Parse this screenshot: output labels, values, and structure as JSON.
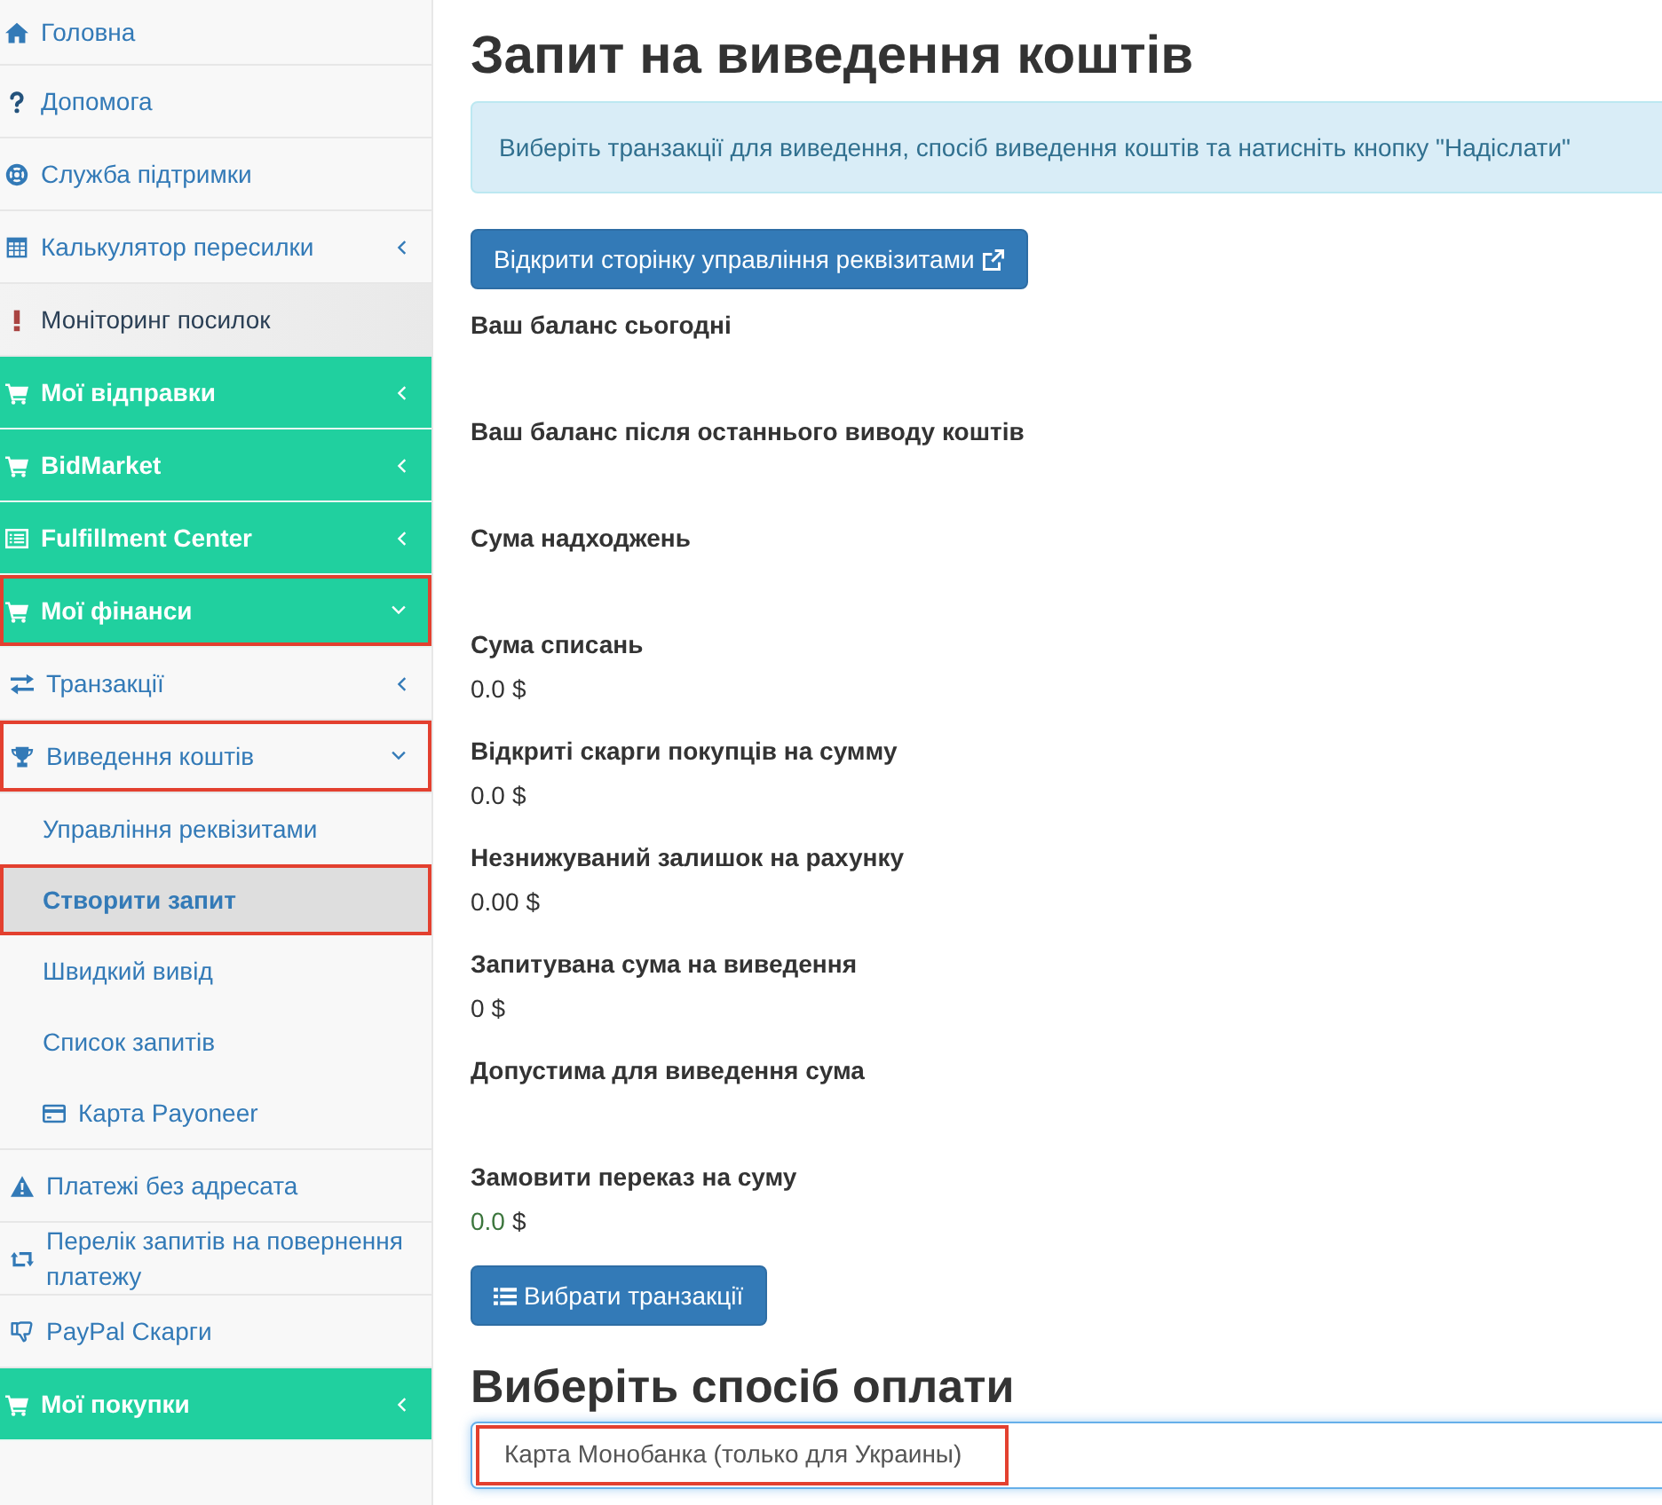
{
  "sidebar": {
    "items": [
      {
        "label": "Головна",
        "kind": "link",
        "selected": false,
        "hovered": false,
        "marked": false
      },
      {
        "label": "Допомога",
        "kind": "link",
        "selected": false,
        "hovered": false,
        "marked": false
      },
      {
        "label": "Служба підтримки",
        "kind": "link",
        "selected": false,
        "hovered": false,
        "marked": false
      },
      {
        "label": "Калькулятор пересилки",
        "kind": "link",
        "selected": false,
        "hovered": false,
        "marked": false,
        "expanded": false
      },
      {
        "label": "Моніторинг посилок",
        "kind": "link",
        "selected": false,
        "hovered": true,
        "marked": false
      },
      {
        "label": "Мої відправки",
        "kind": "section",
        "selected": false,
        "hovered": false,
        "marked": false,
        "expanded": false
      },
      {
        "label": "BidMarket",
        "kind": "section",
        "selected": false,
        "hovered": false,
        "marked": false,
        "expanded": false
      },
      {
        "label": "Fulfillment Center",
        "kind": "section",
        "selected": false,
        "hovered": false,
        "marked": false,
        "expanded": false
      },
      {
        "label": "Мої фінанси",
        "kind": "section",
        "selected": false,
        "hovered": false,
        "marked": true,
        "expanded": true,
        "children": [
          {
            "label": "Транзакції",
            "selected": false,
            "hovered": false,
            "marked": false,
            "expanded": false
          },
          {
            "label": "Виведення коштів",
            "selected": false,
            "hovered": false,
            "marked": true,
            "expanded": true,
            "children": [
              {
                "label": "Управління реквізитами",
                "selected": false,
                "hovered": false,
                "marked": false
              },
              {
                "label": "Створити запит",
                "selected": true,
                "hovered": false,
                "marked": true
              },
              {
                "label": "Швидкий вивід",
                "selected": false,
                "hovered": false,
                "marked": false
              },
              {
                "label": "Список запитів",
                "selected": false,
                "hovered": false,
                "marked": false
              },
              {
                "label": "Карта Payoneer",
                "selected": false,
                "hovered": false,
                "marked": false
              }
            ]
          },
          {
            "label": "Платежі без адресата",
            "selected": false,
            "hovered": false,
            "marked": false
          },
          {
            "label": "Перелік запитів на повернення платежу",
            "selected": false,
            "hovered": false,
            "marked": false
          },
          {
            "label": "PayPal Скарги",
            "selected": false,
            "hovered": false,
            "marked": false
          }
        ]
      },
      {
        "label": "Мої покупки",
        "kind": "section",
        "selected": false,
        "hovered": false,
        "marked": false,
        "expanded": false
      }
    ]
  },
  "page": {
    "title": "Запит на виведення коштів",
    "notice": "Виберіть транзакції для виведення, спосіб виведення коштів та натисніть кнопку \"Надіслати\"",
    "requisites_button": "Відкрити сторінку управління реквізитами",
    "fields": [
      {
        "label": "Ваш баланс сьогодні"
      },
      {
        "label": "Ваш баланс після останнього виводу коштів"
      },
      {
        "label": "Сума надходжень"
      },
      {
        "label": "Сума списань",
        "amount": "0.0",
        "currency": "$"
      },
      {
        "label": "Відкриті скарги покупців на сумму",
        "amount": "0.0",
        "currency": "$"
      },
      {
        "label": "Незнижуваний залишок на рахунку",
        "amount": "0.00",
        "currency": "$"
      },
      {
        "label": "Запитувана сума на виведення",
        "amount": "0",
        "currency": "$"
      },
      {
        "label": "Допустима для виведення сума"
      },
      {
        "label": "Замовити переказ на суму",
        "amount": "0.0",
        "currency": "$",
        "color": "#3c763d"
      }
    ],
    "transactions_button": "Вибрати транзакції",
    "payment_heading": "Виберіть спосіб оплати",
    "payment_method": {
      "value": "Карта Монобанка (только для Украины)",
      "marked": true
    }
  }
}
